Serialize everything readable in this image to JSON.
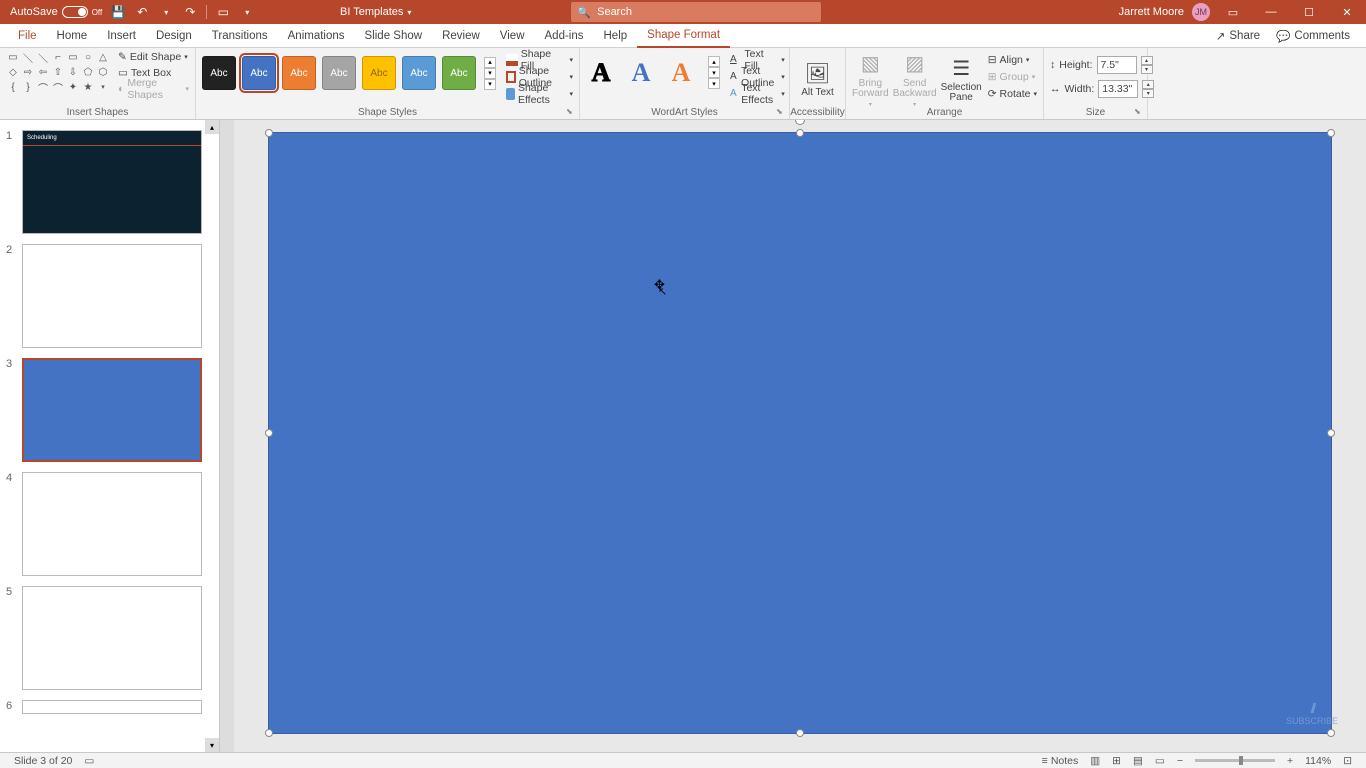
{
  "titlebar": {
    "autosave_label": "AutoSave",
    "autosave_state": "Off",
    "doc_title": "BI Templates",
    "search_placeholder": "Search",
    "user_name": "Jarrett Moore",
    "user_initials": "JM"
  },
  "menu": {
    "file": "File",
    "home": "Home",
    "insert": "Insert",
    "design": "Design",
    "transitions": "Transitions",
    "animations": "Animations",
    "slideshow": "Slide Show",
    "review": "Review",
    "view": "View",
    "addins": "Add-ins",
    "help": "Help",
    "shape_format": "Shape Format",
    "share": "Share",
    "comments": "Comments"
  },
  "ribbon": {
    "insert_shapes": {
      "label": "Insert Shapes",
      "edit_shape": "Edit Shape",
      "text_box": "Text Box",
      "merge_shapes": "Merge Shapes"
    },
    "shape_styles": {
      "label": "Shape Styles",
      "preset_label": "Abc",
      "shape_fill": "Shape Fill",
      "shape_outline": "Shape Outline",
      "shape_effects": "Shape Effects"
    },
    "wordart": {
      "label": "WordArt Styles",
      "preset_letter": "A",
      "text_fill": "Text Fill",
      "text_outline": "Text Outline",
      "text_effects": "Text Effects"
    },
    "accessibility": {
      "label": "Accessibility",
      "alt_text": "Alt Text"
    },
    "arrange": {
      "label": "Arrange",
      "bring_forward": "Bring Forward",
      "send_backward": "Send Backward",
      "selection_pane": "Selection Pane",
      "align": "Align",
      "group": "Group",
      "rotate": "Rotate"
    },
    "size": {
      "label": "Size",
      "height_label": "Height:",
      "height_value": "7.5\"",
      "width_label": "Width:",
      "width_value": "13.33\""
    }
  },
  "slides": {
    "thumbs": [
      "1",
      "2",
      "3",
      "4",
      "5",
      "6"
    ]
  },
  "status": {
    "slide_pos": "Slide 3 of 20",
    "notes": "Notes",
    "zoom": "114%"
  },
  "watermark": "SUBSCRIBE"
}
